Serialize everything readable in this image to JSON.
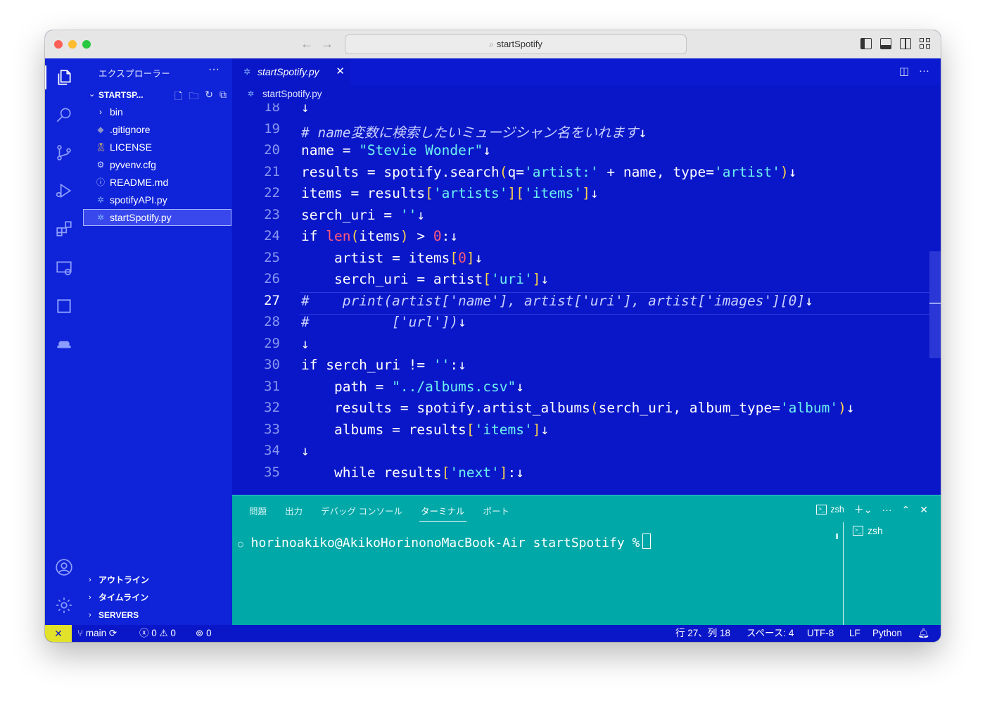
{
  "window": {
    "command_center": "startSpotify"
  },
  "sidebar": {
    "title": "エクスプローラー",
    "more": "···",
    "section": "STARTSP...",
    "files": [
      {
        "label": "bin",
        "icon": "chevron-right-icon",
        "glyph": "›"
      },
      {
        "label": ".gitignore",
        "icon": "git-icon",
        "glyph": "◆"
      },
      {
        "label": "LICENSE",
        "icon": "license-icon",
        "glyph": "🎗"
      },
      {
        "label": "pyvenv.cfg",
        "icon": "gear-icon",
        "glyph": "⚙"
      },
      {
        "label": "README.md",
        "icon": "info-icon",
        "glyph": "ⓘ"
      },
      {
        "label": "spotifyAPI.py",
        "icon": "python-icon",
        "glyph": "✲"
      },
      {
        "label": "startSpotify.py",
        "icon": "python-icon",
        "glyph": "✲"
      }
    ],
    "bottom_sections": [
      "アウトライン",
      "タイムライン",
      "SERVERS"
    ]
  },
  "editor": {
    "tab_label": "startSpotify.py",
    "breadcrumb": "startSpotify.py",
    "current_line": 27,
    "line_numbers": [
      "18",
      "19",
      "20",
      "21",
      "22",
      "23",
      "24",
      "25",
      "26",
      "27",
      "28",
      "29",
      "30",
      "31",
      "32",
      "33",
      "34",
      "35"
    ]
  },
  "panel": {
    "tabs": [
      "問題",
      "出力",
      "デバッグ コンソール",
      "ターミナル",
      "ポート"
    ],
    "active_tab": "ターミナル",
    "shell_label": "zsh",
    "prompt": "horinoakiko@AkikoHorinonoMacBook-Air startSpotify %",
    "side_terminal": "zsh"
  },
  "statusbar": {
    "remote_glyph": "✕",
    "branch": "main",
    "errors": "0",
    "warnings": "0",
    "ports": "0",
    "position": "行 27、列 18",
    "spaces": "スペース: 4",
    "encoding": "UTF-8",
    "eol": "LF",
    "language": "Python"
  },
  "colors": {
    "accent": "#0a17c8",
    "panel": "#00a8a8",
    "remote": "#e2e22a",
    "string": "#6cf0f0",
    "number": "#ff5a7a",
    "bracket": "#ffd24d"
  }
}
